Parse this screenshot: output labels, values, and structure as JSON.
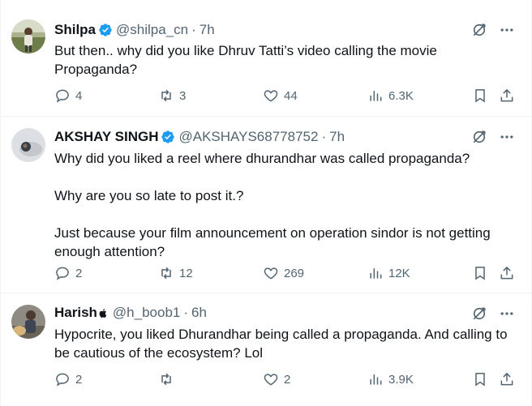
{
  "tweets": [
    {
      "name": "Shilpa",
      "verified": true,
      "apple_badge": false,
      "handle": "@shilpa_cn",
      "separator": "·",
      "time": "7h",
      "text": [
        "But then.. why did you like Dhruv Tatti’s video calling the movie Propaganda?"
      ],
      "replies": "4",
      "retweets": "3",
      "likes": "44",
      "views": "6.3K"
    },
    {
      "name": "AKSHAY SINGH",
      "verified": true,
      "apple_badge": false,
      "handle": "@AKSHAYS68778752",
      "separator": "·",
      "time": "7h",
      "text": [
        "Why did you liked a reel where dhurandhar was called propaganda?",
        "Why are you so late to post it.?",
        "Just because your film announcement on operation sindor is not getting enough attention?"
      ],
      "replies": "2",
      "retweets": "12",
      "likes": "269",
      "views": "12K"
    },
    {
      "name": "Harish",
      "verified": false,
      "apple_badge": true,
      "handle": "@h_boob1",
      "separator": "·",
      "time": "6h",
      "text": [
        "Hypocrite, you liked Dhurandhar being called a propaganda. And calling to be cautious of the ecosystem? Lol"
      ],
      "replies": "2",
      "retweets": "",
      "likes": "2",
      "views": "3.9K"
    }
  ],
  "colors": {
    "text": "#0f1419",
    "secondary": "#536471",
    "verified": "#1d9bf0",
    "divider": "#eff3f4"
  },
  "icons": [
    "verified-badge-icon",
    "apple-icon",
    "grok-icon",
    "more-icon",
    "reply-icon",
    "retweet-icon",
    "like-icon",
    "views-icon",
    "bookmark-icon",
    "share-icon"
  ]
}
